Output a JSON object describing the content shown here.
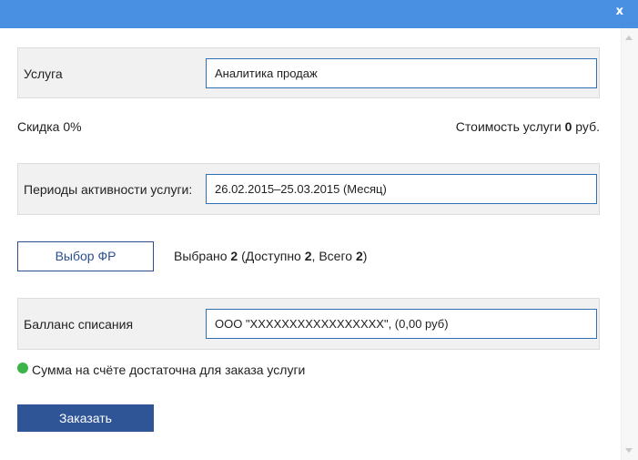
{
  "window": {
    "close_glyph": "x"
  },
  "service": {
    "label": "Услуга",
    "value": "Аналитика продаж"
  },
  "discount": {
    "text": "Скидка 0%"
  },
  "cost": {
    "prefix": "Стоимость услуги ",
    "amount": "0",
    "suffix": " руб."
  },
  "periods": {
    "label": "Периоды активности услуги:",
    "value": "26.02.2015–25.03.2015 (Месяц)"
  },
  "fr_select": {
    "button_label": "Выбор ФР",
    "selected_prefix": "Выбрано ",
    "selected_count": "2",
    "available_prefix": " (Доступно ",
    "available_count": "2",
    "total_prefix": ", Всего ",
    "total_count": "2",
    "suffix": ")"
  },
  "balance": {
    "label": "Балланс списания",
    "value": "ООО \"XXXXXXXXXXXXXXXXX\", (0,00 руб)"
  },
  "status": {
    "message": "Сумма на счёте достаточна для заказа услуги",
    "color": "#3bb54a"
  },
  "order_button": {
    "label": "Заказать"
  },
  "colors": {
    "titlebar": "#4a90e2",
    "primary": "#2f5597",
    "field_border": "#2f6fb5"
  }
}
